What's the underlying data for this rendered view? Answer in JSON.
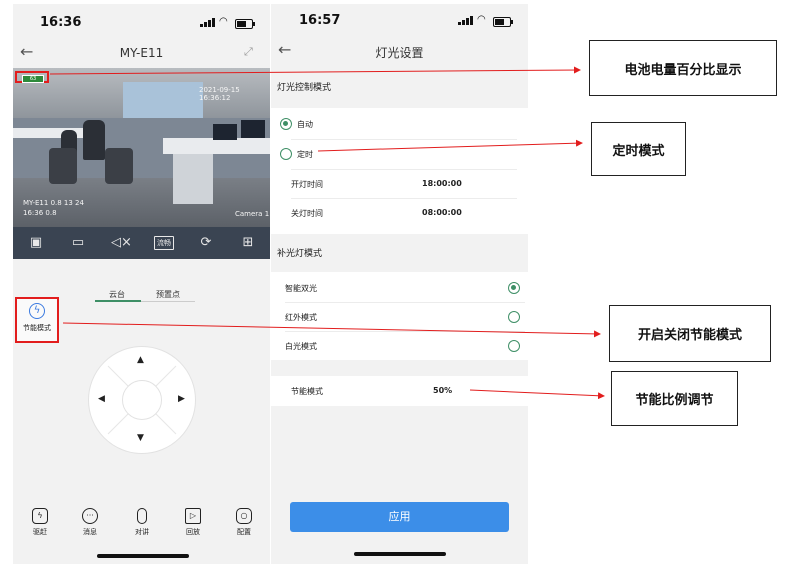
{
  "phone1": {
    "time": "16:36",
    "title": "MY-E11",
    "video": {
      "battery_label": "63",
      "overlay_top": "2021-09-15 16:36:12",
      "overlay_bottom_1": "MY-E11 0.8 13 24",
      "overlay_bottom_2": "16:36 0.8",
      "overlay_camera": "Camera 1"
    },
    "toolbar": {
      "quality_label": "流畅"
    },
    "tabs": [
      "云台",
      "预置点"
    ],
    "eco_label": "节能模式",
    "bottom_nav": [
      {
        "label": "驱赶",
        "icon": "lightning-icon"
      },
      {
        "label": "消息",
        "icon": "message-icon"
      },
      {
        "label": "对讲",
        "icon": "mic-icon"
      },
      {
        "label": "回放",
        "icon": "playback-icon"
      },
      {
        "label": "配置",
        "icon": "settings-icon"
      }
    ]
  },
  "phone2": {
    "time": "16:57",
    "title": "灯光设置",
    "light_control": {
      "section_title": "灯光控制模式",
      "options": [
        {
          "label": "自动",
          "selected": true
        },
        {
          "label": "定时",
          "selected": false
        }
      ],
      "on_time_label": "开灯时间",
      "on_time_value": "18:00:00",
      "off_time_label": "关灯时间",
      "off_time_value": "08:00:00"
    },
    "fill_light": {
      "section_title": "补光灯模式",
      "options": [
        {
          "label": "智能双光",
          "selected": true
        },
        {
          "label": "红外模式",
          "selected": false
        },
        {
          "label": "白光模式",
          "selected": false
        }
      ]
    },
    "eco": {
      "label": "节能模式",
      "value": "50%"
    },
    "apply_label": "应用"
  },
  "callouts": {
    "battery": "电池电量百分比显示",
    "timer": "定时模式",
    "eco_toggle": "开启关闭节能模式",
    "eco_ratio": "节能比例调节"
  },
  "colors": {
    "accent_green": "#3e8f66",
    "apply_blue": "#3c8ee8",
    "annotation_red": "#e21d1d"
  }
}
